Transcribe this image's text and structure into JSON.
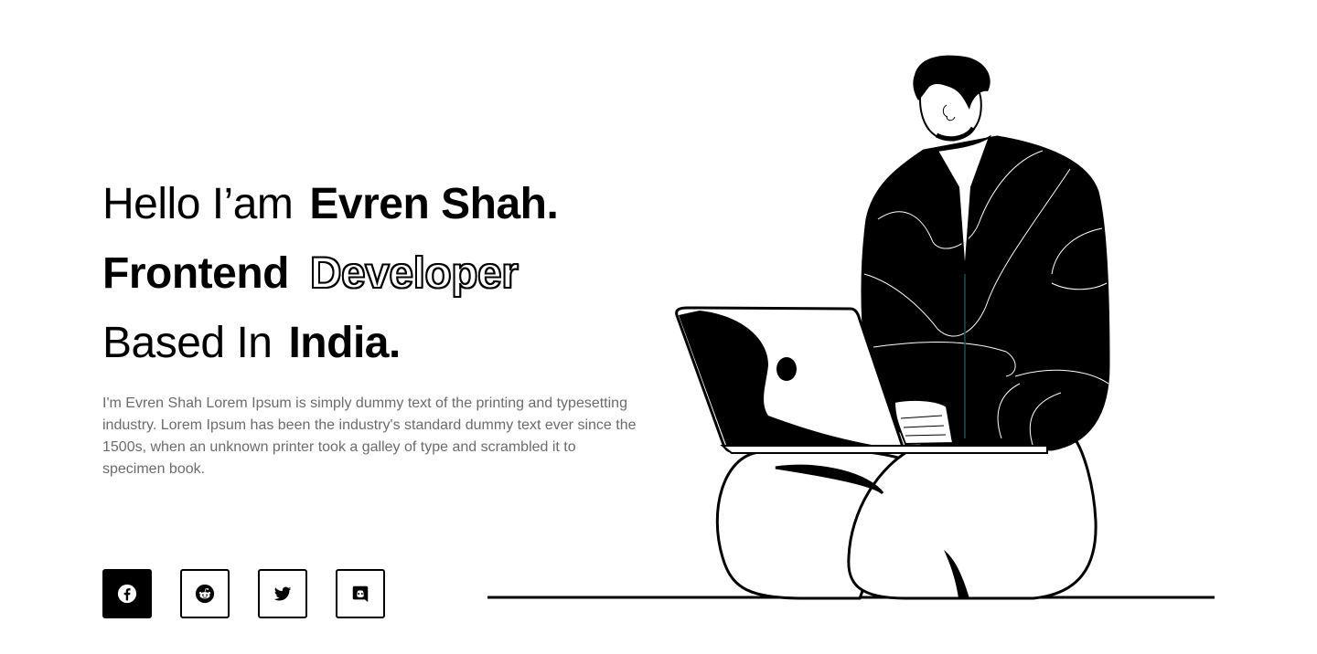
{
  "hero": {
    "line1": {
      "light": "Hello I’am",
      "bold": "Evren Shah."
    },
    "line2": {
      "bold": "Frontend",
      "outline": "Developer"
    },
    "line3": {
      "light": "Based In",
      "bold": "India."
    }
  },
  "bio": "I'm Evren Shah Lorem Ipsum is simply dummy text of the printing and typesetting industry. Lorem Ipsum has been the industry's standard dummy text ever since the 1500s, when an unknown printer took a galley of type and scrambled it to specimen book.",
  "socials": [
    {
      "icon": "facebook-icon",
      "active": true
    },
    {
      "icon": "reddit-icon",
      "active": false
    },
    {
      "icon": "twitter-icon",
      "active": false
    },
    {
      "icon": "discord-icon",
      "active": false
    }
  ],
  "colors": {
    "text": "#000000",
    "muted": "#6b6b6b",
    "background": "#ffffff"
  }
}
